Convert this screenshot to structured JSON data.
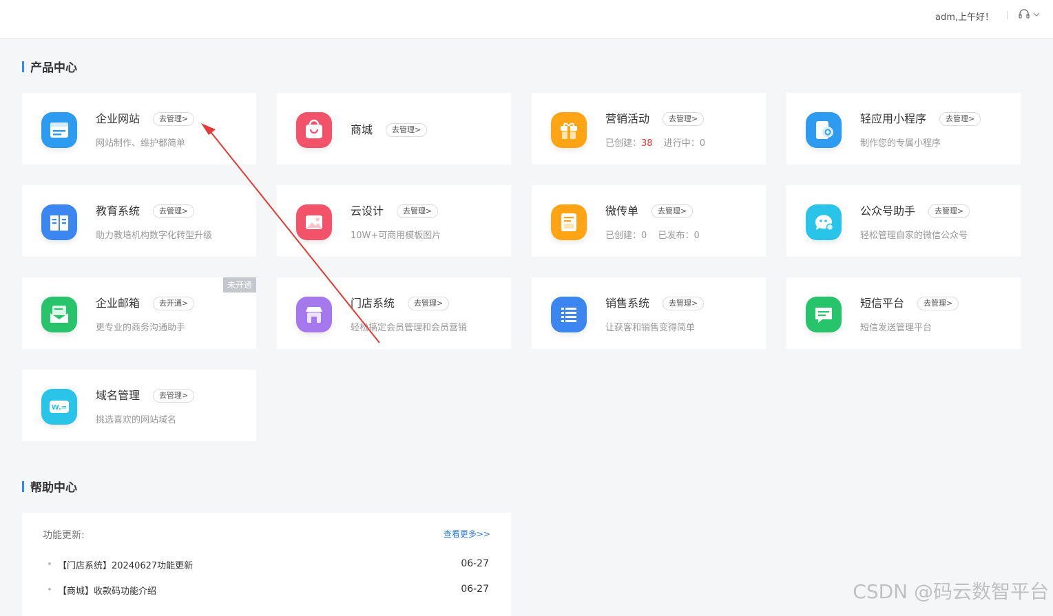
{
  "header": {
    "greeting": "adm,上午好！",
    "support_icon": "headset-icon",
    "dropdown_icon": "chevron-down-icon"
  },
  "product_center": {
    "title": "产品中心",
    "cards": [
      {
        "title": "企业网站",
        "button": "去管理>",
        "desc": "网站制作、维护都简单",
        "icon": "browser-icon",
        "color": "#2d9bf0"
      },
      {
        "title": "商城",
        "button": "去管理>",
        "icon": "shopping-bag-icon",
        "color": "#f2526a"
      },
      {
        "title": "营销活动",
        "button": "去管理>",
        "stat1_label": "已创建：",
        "stat1_value": "38",
        "stat2_label": "进行中：",
        "stat2_value": "0",
        "icon": "gift-icon",
        "color": "#ffa415"
      },
      {
        "title": "轻应用小程序",
        "button": "去管理>",
        "desc": "制作您的专属小程序",
        "icon": "mini-program-icon",
        "color": "#2d9bf0"
      },
      {
        "title": "教育系统",
        "button": "去管理>",
        "desc": "助力教培机构数字化转型升级",
        "icon": "book-icon",
        "color": "#3b86f0"
      },
      {
        "title": "云设计",
        "button": "去管理>",
        "desc": "10W+可商用模板图片",
        "icon": "image-icon",
        "color": "#f2526a"
      },
      {
        "title": "微传单",
        "button": "去管理>",
        "stat1_label": "已创建：",
        "stat1_value": "0",
        "stat2_label": "已发布：",
        "stat2_value": "0",
        "icon": "flyer-icon",
        "color": "#ffa415"
      },
      {
        "title": "公众号助手",
        "button": "去管理>",
        "desc": "轻松管理自家的微信公众号",
        "icon": "chat-gear-icon",
        "color": "#2ac4e8"
      },
      {
        "title": "企业邮箱",
        "button": "去开通>",
        "desc": "更专业的商务沟通助手",
        "badge": "未开通",
        "icon": "mail-icon",
        "color": "#27c46b"
      },
      {
        "title": "门店系统",
        "button": "去管理>",
        "desc": "轻松搞定会员管理和会员营销",
        "icon": "store-icon",
        "color": "#a678ee"
      },
      {
        "title": "销售系统",
        "button": "去管理>",
        "desc": "让获客和销售变得简单",
        "icon": "list-icon",
        "color": "#3b86f0"
      },
      {
        "title": "短信平台",
        "button": "去管理>",
        "desc": "短信发送管理平台",
        "icon": "message-icon",
        "color": "#27c46b"
      },
      {
        "title": "域名管理",
        "button": "去管理>",
        "desc": "挑选喜欢的网站域名",
        "icon": "domain-icon",
        "color": "#2ac4e8"
      }
    ]
  },
  "help_center": {
    "title": "帮助中心",
    "label": "功能更新:",
    "more": "查看更多>>",
    "items": [
      {
        "text": "【门店系统】20240627功能更新",
        "date": "06-27"
      },
      {
        "text": "【商城】收款码功能介绍",
        "date": "06-27"
      }
    ]
  },
  "watermark": "CSDN @码云数智平台",
  "annotation_arrow": {
    "color": "#e53935"
  }
}
